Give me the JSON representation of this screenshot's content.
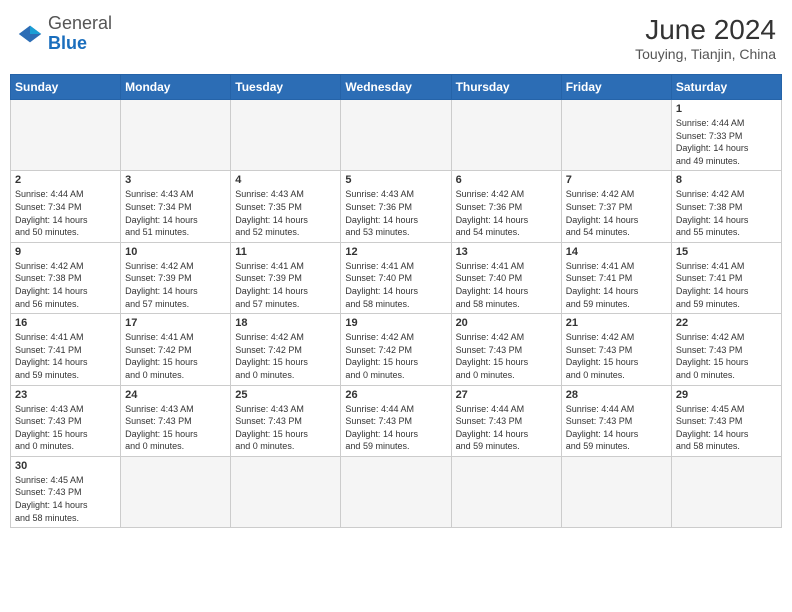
{
  "header": {
    "logo_general": "General",
    "logo_blue": "Blue",
    "title": "June 2024",
    "subtitle": "Touying, Tianjin, China"
  },
  "days_of_week": [
    "Sunday",
    "Monday",
    "Tuesday",
    "Wednesday",
    "Thursday",
    "Friday",
    "Saturday"
  ],
  "weeks": [
    [
      {
        "day": "",
        "info": ""
      },
      {
        "day": "",
        "info": ""
      },
      {
        "day": "",
        "info": ""
      },
      {
        "day": "",
        "info": ""
      },
      {
        "day": "",
        "info": ""
      },
      {
        "day": "",
        "info": ""
      },
      {
        "day": "1",
        "info": "Sunrise: 4:44 AM\nSunset: 7:33 PM\nDaylight: 14 hours\nand 49 minutes."
      }
    ],
    [
      {
        "day": "2",
        "info": "Sunrise: 4:44 AM\nSunset: 7:34 PM\nDaylight: 14 hours\nand 50 minutes."
      },
      {
        "day": "3",
        "info": "Sunrise: 4:43 AM\nSunset: 7:34 PM\nDaylight: 14 hours\nand 51 minutes."
      },
      {
        "day": "4",
        "info": "Sunrise: 4:43 AM\nSunset: 7:35 PM\nDaylight: 14 hours\nand 52 minutes."
      },
      {
        "day": "5",
        "info": "Sunrise: 4:43 AM\nSunset: 7:36 PM\nDaylight: 14 hours\nand 53 minutes."
      },
      {
        "day": "6",
        "info": "Sunrise: 4:42 AM\nSunset: 7:36 PM\nDaylight: 14 hours\nand 54 minutes."
      },
      {
        "day": "7",
        "info": "Sunrise: 4:42 AM\nSunset: 7:37 PM\nDaylight: 14 hours\nand 54 minutes."
      },
      {
        "day": "8",
        "info": "Sunrise: 4:42 AM\nSunset: 7:38 PM\nDaylight: 14 hours\nand 55 minutes."
      }
    ],
    [
      {
        "day": "9",
        "info": "Sunrise: 4:42 AM\nSunset: 7:38 PM\nDaylight: 14 hours\nand 56 minutes."
      },
      {
        "day": "10",
        "info": "Sunrise: 4:42 AM\nSunset: 7:39 PM\nDaylight: 14 hours\nand 57 minutes."
      },
      {
        "day": "11",
        "info": "Sunrise: 4:41 AM\nSunset: 7:39 PM\nDaylight: 14 hours\nand 57 minutes."
      },
      {
        "day": "12",
        "info": "Sunrise: 4:41 AM\nSunset: 7:40 PM\nDaylight: 14 hours\nand 58 minutes."
      },
      {
        "day": "13",
        "info": "Sunrise: 4:41 AM\nSunset: 7:40 PM\nDaylight: 14 hours\nand 58 minutes."
      },
      {
        "day": "14",
        "info": "Sunrise: 4:41 AM\nSunset: 7:41 PM\nDaylight: 14 hours\nand 59 minutes."
      },
      {
        "day": "15",
        "info": "Sunrise: 4:41 AM\nSunset: 7:41 PM\nDaylight: 14 hours\nand 59 minutes."
      }
    ],
    [
      {
        "day": "16",
        "info": "Sunrise: 4:41 AM\nSunset: 7:41 PM\nDaylight: 14 hours\nand 59 minutes."
      },
      {
        "day": "17",
        "info": "Sunrise: 4:41 AM\nSunset: 7:42 PM\nDaylight: 15 hours\nand 0 minutes."
      },
      {
        "day": "18",
        "info": "Sunrise: 4:42 AM\nSunset: 7:42 PM\nDaylight: 15 hours\nand 0 minutes."
      },
      {
        "day": "19",
        "info": "Sunrise: 4:42 AM\nSunset: 7:42 PM\nDaylight: 15 hours\nand 0 minutes."
      },
      {
        "day": "20",
        "info": "Sunrise: 4:42 AM\nSunset: 7:43 PM\nDaylight: 15 hours\nand 0 minutes."
      },
      {
        "day": "21",
        "info": "Sunrise: 4:42 AM\nSunset: 7:43 PM\nDaylight: 15 hours\nand 0 minutes."
      },
      {
        "day": "22",
        "info": "Sunrise: 4:42 AM\nSunset: 7:43 PM\nDaylight: 15 hours\nand 0 minutes."
      }
    ],
    [
      {
        "day": "23",
        "info": "Sunrise: 4:43 AM\nSunset: 7:43 PM\nDaylight: 15 hours\nand 0 minutes."
      },
      {
        "day": "24",
        "info": "Sunrise: 4:43 AM\nSunset: 7:43 PM\nDaylight: 15 hours\nand 0 minutes."
      },
      {
        "day": "25",
        "info": "Sunrise: 4:43 AM\nSunset: 7:43 PM\nDaylight: 15 hours\nand 0 minutes."
      },
      {
        "day": "26",
        "info": "Sunrise: 4:44 AM\nSunset: 7:43 PM\nDaylight: 14 hours\nand 59 minutes."
      },
      {
        "day": "27",
        "info": "Sunrise: 4:44 AM\nSunset: 7:43 PM\nDaylight: 14 hours\nand 59 minutes."
      },
      {
        "day": "28",
        "info": "Sunrise: 4:44 AM\nSunset: 7:43 PM\nDaylight: 14 hours\nand 59 minutes."
      },
      {
        "day": "29",
        "info": "Sunrise: 4:45 AM\nSunset: 7:43 PM\nDaylight: 14 hours\nand 58 minutes."
      }
    ],
    [
      {
        "day": "30",
        "info": "Sunrise: 4:45 AM\nSunset: 7:43 PM\nDaylight: 14 hours\nand 58 minutes."
      },
      {
        "day": "",
        "info": ""
      },
      {
        "day": "",
        "info": ""
      },
      {
        "day": "",
        "info": ""
      },
      {
        "day": "",
        "info": ""
      },
      {
        "day": "",
        "info": ""
      },
      {
        "day": "",
        "info": ""
      }
    ]
  ]
}
